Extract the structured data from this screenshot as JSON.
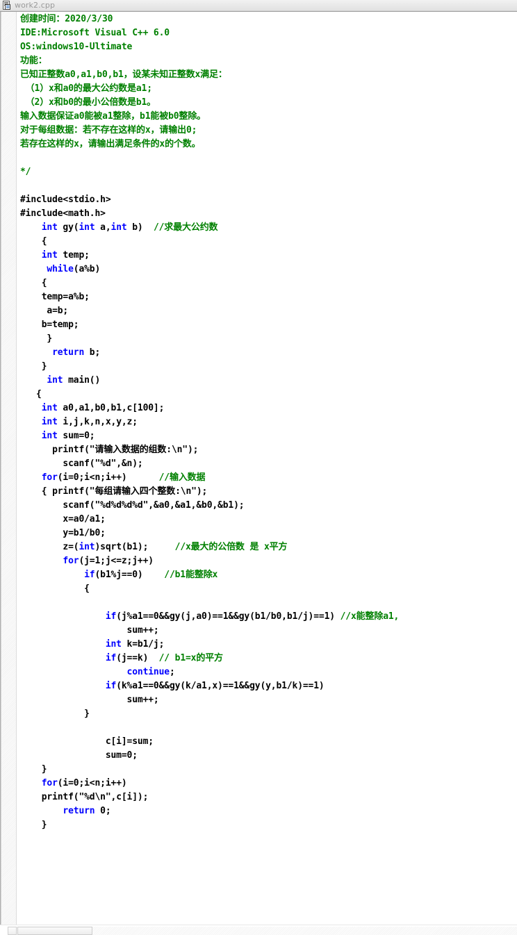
{
  "window": {
    "title": "work2.cpp",
    "icon": "cpp-document-icon"
  },
  "scrollbar": {
    "left_arrow": "scroll-left-arrow",
    "thumb": "horizontal-scroll-thumb"
  },
  "colors": {
    "comment": "#008000",
    "keyword": "#0000ff",
    "plain": "#000000",
    "background": "#ffffff",
    "title_text": "#9a9a9a"
  },
  "code_lines": [
    {
      "indent": 0,
      "parts": [
        {
          "t": "cm",
          "s": "创建时间：2020/3/30"
        }
      ]
    },
    {
      "indent": 0,
      "parts": [
        {
          "t": "cm",
          "s": "IDE:Microsoft Visual C++ 6.0"
        }
      ]
    },
    {
      "indent": 0,
      "parts": [
        {
          "t": "cm",
          "s": "OS:windows10-Ultimate"
        }
      ]
    },
    {
      "indent": 0,
      "parts": [
        {
          "t": "cm",
          "s": "功能："
        }
      ]
    },
    {
      "indent": 0,
      "parts": [
        {
          "t": "cm",
          "s": "已知正整数a0,a1,b0,b1，设某未知正整数x满足："
        }
      ]
    },
    {
      "indent": 0,
      "parts": [
        {
          "t": "cm",
          "s": " （1）x和a0的最大公约数是a1;"
        }
      ]
    },
    {
      "indent": 0,
      "parts": [
        {
          "t": "cm",
          "s": " （2）x和b0的最小公倍数是b1。"
        }
      ]
    },
    {
      "indent": 0,
      "parts": [
        {
          "t": "cm",
          "s": "输入数据保证a0能被a1整除，b1能被b0整除。"
        }
      ]
    },
    {
      "indent": 0,
      "parts": [
        {
          "t": "cm",
          "s": "对于每组数据：若不存在这样的x，请输出0;"
        }
      ]
    },
    {
      "indent": 0,
      "parts": [
        {
          "t": "cm",
          "s": "若存在这样的x，请输出满足条件的x的个数。"
        }
      ]
    },
    {
      "indent": 0,
      "parts": []
    },
    {
      "indent": 0,
      "parts": [
        {
          "t": "cm",
          "s": "*/"
        }
      ]
    },
    {
      "indent": 0,
      "parts": []
    },
    {
      "indent": 0,
      "parts": [
        {
          "t": "pp",
          "s": "#include<stdio.h>"
        }
      ]
    },
    {
      "indent": 0,
      "parts": [
        {
          "t": "pp",
          "s": "#include<math.h>"
        }
      ]
    },
    {
      "indent": 0,
      "parts": [
        {
          "t": "kw",
          "s": "int"
        },
        {
          "t": "pl",
          "s": " gy("
        },
        {
          "t": "kw",
          "s": "int"
        },
        {
          "t": "pl",
          "s": " a,"
        },
        {
          "t": "kw",
          "s": "int"
        },
        {
          "t": "pl",
          "s": " b)  "
        },
        {
          "t": "cm",
          "s": "//求最大公约数"
        }
      ],
      "pad": 4
    },
    {
      "indent": 0,
      "parts": [
        {
          "t": "pl",
          "s": "{"
        }
      ],
      "pad": 4
    },
    {
      "indent": 0,
      "parts": [
        {
          "t": "kw",
          "s": "int"
        },
        {
          "t": "pl",
          "s": " temp;"
        }
      ],
      "pad": 4
    },
    {
      "indent": 0,
      "parts": [
        {
          "t": "kw",
          "s": "while"
        },
        {
          "t": "pl",
          "s": "(a%b)"
        }
      ],
      "pad": 5
    },
    {
      "indent": 0,
      "parts": [
        {
          "t": "pl",
          "s": "{"
        }
      ],
      "pad": 4
    },
    {
      "indent": 0,
      "parts": [
        {
          "t": "pl",
          "s": "temp=a%b;"
        }
      ],
      "pad": 4
    },
    {
      "indent": 0,
      "parts": [
        {
          "t": "pl",
          "s": "a=b;"
        }
      ],
      "pad": 5
    },
    {
      "indent": 0,
      "parts": [
        {
          "t": "pl",
          "s": "b=temp;"
        }
      ],
      "pad": 4
    },
    {
      "indent": 0,
      "parts": [
        {
          "t": "pl",
          "s": "}"
        }
      ],
      "pad": 5
    },
    {
      "indent": 0,
      "parts": [
        {
          "t": "kw",
          "s": "return"
        },
        {
          "t": "pl",
          "s": " b;"
        }
      ],
      "pad": 6
    },
    {
      "indent": 0,
      "parts": [
        {
          "t": "pl",
          "s": "}"
        }
      ],
      "pad": 4
    },
    {
      "indent": 0,
      "parts": [
        {
          "t": "kw",
          "s": "int"
        },
        {
          "t": "pl",
          "s": " main()"
        }
      ],
      "pad": 5
    },
    {
      "indent": 0,
      "parts": [
        {
          "t": "pl",
          "s": "{"
        }
      ],
      "pad": 3
    },
    {
      "indent": 0,
      "parts": [
        {
          "t": "kw",
          "s": "int"
        },
        {
          "t": "pl",
          "s": " a0,a1,b0,b1,c[100];"
        }
      ],
      "pad": 4
    },
    {
      "indent": 0,
      "parts": [
        {
          "t": "kw",
          "s": "int"
        },
        {
          "t": "pl",
          "s": " i,j,k,n,x,y,z;"
        }
      ],
      "pad": 4
    },
    {
      "indent": 0,
      "parts": [
        {
          "t": "kw",
          "s": "int"
        },
        {
          "t": "pl",
          "s": " sum=0;"
        }
      ],
      "pad": 4
    },
    {
      "indent": 0,
      "parts": [
        {
          "t": "pl",
          "s": "printf(\"请输入数据的组数:\\n\");"
        }
      ],
      "pad": 6
    },
    {
      "indent": 0,
      "parts": [
        {
          "t": "pl",
          "s": "scanf(\"%d\",&n);"
        }
      ],
      "pad": 8
    },
    {
      "indent": 0,
      "parts": [
        {
          "t": "kw",
          "s": "for"
        },
        {
          "t": "pl",
          "s": "(i=0;i<n;i++)      "
        },
        {
          "t": "cm",
          "s": "//输入数据"
        }
      ],
      "pad": 4
    },
    {
      "indent": 0,
      "parts": [
        {
          "t": "pl",
          "s": "{ printf(\"每组请输入四个整数:\\n\");"
        }
      ],
      "pad": 4
    },
    {
      "indent": 0,
      "parts": [
        {
          "t": "pl",
          "s": "scanf(\"%d%d%d%d\",&a0,&a1,&b0,&b1);"
        }
      ],
      "pad": 8
    },
    {
      "indent": 0,
      "parts": [
        {
          "t": "pl",
          "s": "x=a0/a1;"
        }
      ],
      "pad": 8
    },
    {
      "indent": 0,
      "parts": [
        {
          "t": "pl",
          "s": "y=b1/b0;"
        }
      ],
      "pad": 8
    },
    {
      "indent": 0,
      "parts": [
        {
          "t": "pl",
          "s": "z=("
        },
        {
          "t": "kw",
          "s": "int"
        },
        {
          "t": "pl",
          "s": ")sqrt(b1);     "
        },
        {
          "t": "cm",
          "s": "//x最大的公倍数 是 x平方"
        }
      ],
      "pad": 8
    },
    {
      "indent": 0,
      "parts": [
        {
          "t": "kw",
          "s": "for"
        },
        {
          "t": "pl",
          "s": "(j=1;j<=z;j++)"
        }
      ],
      "pad": 8
    },
    {
      "indent": 0,
      "parts": [
        {
          "t": "kw",
          "s": "if"
        },
        {
          "t": "pl",
          "s": "(b1%j==0)    "
        },
        {
          "t": "cm",
          "s": "//b1能整除x"
        }
      ],
      "pad": 12
    },
    {
      "indent": 0,
      "parts": [
        {
          "t": "pl",
          "s": "{"
        }
      ],
      "pad": 12
    },
    {
      "indent": 0,
      "parts": []
    },
    {
      "indent": 0,
      "parts": [
        {
          "t": "kw",
          "s": "if"
        },
        {
          "t": "pl",
          "s": "(j%a1==0&&gy(j,a0)==1&&gy(b1/b0,b1/j)==1) "
        },
        {
          "t": "cm",
          "s": "//x能整除a1,"
        }
      ],
      "pad": 16
    },
    {
      "indent": 0,
      "parts": [
        {
          "t": "pl",
          "s": "sum++;"
        }
      ],
      "pad": 20
    },
    {
      "indent": 0,
      "parts": [
        {
          "t": "kw",
          "s": "int"
        },
        {
          "t": "pl",
          "s": " k=b1/j;"
        }
      ],
      "pad": 16
    },
    {
      "indent": 0,
      "parts": [
        {
          "t": "kw",
          "s": "if"
        },
        {
          "t": "pl",
          "s": "(j==k)  "
        },
        {
          "t": "cm",
          "s": "// b1=x的平方"
        }
      ],
      "pad": 16
    },
    {
      "indent": 0,
      "parts": [
        {
          "t": "kw",
          "s": "continue"
        },
        {
          "t": "pl",
          "s": ";"
        }
      ],
      "pad": 20
    },
    {
      "indent": 0,
      "parts": [
        {
          "t": "kw",
          "s": "if"
        },
        {
          "t": "pl",
          "s": "(k%a1==0&&gy(k/a1,x)==1&&gy(y,b1/k)==1)"
        }
      ],
      "pad": 16
    },
    {
      "indent": 0,
      "parts": [
        {
          "t": "pl",
          "s": "sum++;"
        }
      ],
      "pad": 20
    },
    {
      "indent": 0,
      "parts": [
        {
          "t": "pl",
          "s": "}"
        }
      ],
      "pad": 12
    },
    {
      "indent": 0,
      "parts": []
    },
    {
      "indent": 0,
      "parts": [
        {
          "t": "pl",
          "s": "c[i]=sum;"
        }
      ],
      "pad": 16
    },
    {
      "indent": 0,
      "parts": [
        {
          "t": "pl",
          "s": "sum=0;"
        }
      ],
      "pad": 16
    },
    {
      "indent": 0,
      "parts": [
        {
          "t": "pl",
          "s": "}"
        }
      ],
      "pad": 4
    },
    {
      "indent": 0,
      "parts": [
        {
          "t": "kw",
          "s": "for"
        },
        {
          "t": "pl",
          "s": "(i=0;i<n;i++)"
        }
      ],
      "pad": 4
    },
    {
      "indent": 0,
      "parts": [
        {
          "t": "pl",
          "s": "printf(\"%d\\n\",c[i]);"
        }
      ],
      "pad": 4
    },
    {
      "indent": 0,
      "parts": [
        {
          "t": "kw",
          "s": "return"
        },
        {
          "t": "pl",
          "s": " 0;"
        }
      ],
      "pad": 8
    },
    {
      "indent": 0,
      "parts": [
        {
          "t": "pl",
          "s": "}"
        }
      ],
      "pad": 4
    }
  ]
}
